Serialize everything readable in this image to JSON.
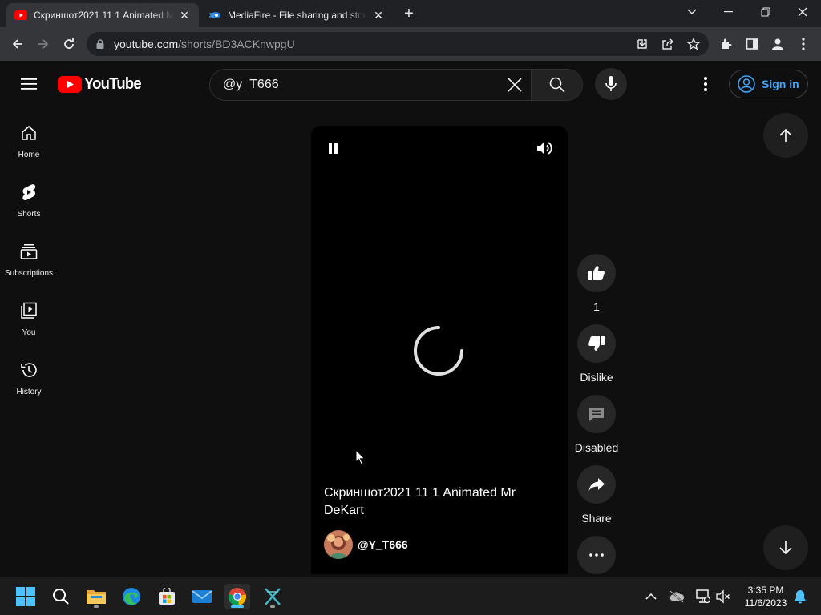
{
  "browser": {
    "tabs": [
      {
        "title": "Скриншот2021 11 1 Animated Mr DeKart",
        "icon": "youtube-favicon-icon",
        "active": true
      },
      {
        "title": "MediaFire - File sharing and storage",
        "icon": "mediafire-favicon-icon",
        "active": false
      }
    ],
    "url_host": "youtube.com",
    "url_path": "/shorts/BD3ACKnwpgU"
  },
  "youtube": {
    "logo_text": "YouTube",
    "search_value": "@y_T666",
    "signin_label": "Sign in",
    "sidebar": [
      {
        "label": "Home",
        "icon": "home-icon"
      },
      {
        "label": "Shorts",
        "icon": "shorts-icon"
      },
      {
        "label": "Subscriptions",
        "icon": "subscriptions-icon"
      },
      {
        "label": "You",
        "icon": "you-icon"
      },
      {
        "label": "History",
        "icon": "history-icon"
      }
    ],
    "short": {
      "title": "Скриншот2021 11 1 Animated Mr DeKart",
      "channel": "@Y_T666"
    },
    "actions": {
      "like_count": "1",
      "dislike_label": "Dislike",
      "comments_label": "Disabled",
      "share_label": "Share"
    }
  },
  "taskbar": {
    "time": "3:35 PM",
    "date": "11/6/2023"
  },
  "colors": {
    "youtube_red": "#ff0000",
    "link_blue": "#3ea6ff",
    "taskbar_accent": "#4cc2ff"
  }
}
